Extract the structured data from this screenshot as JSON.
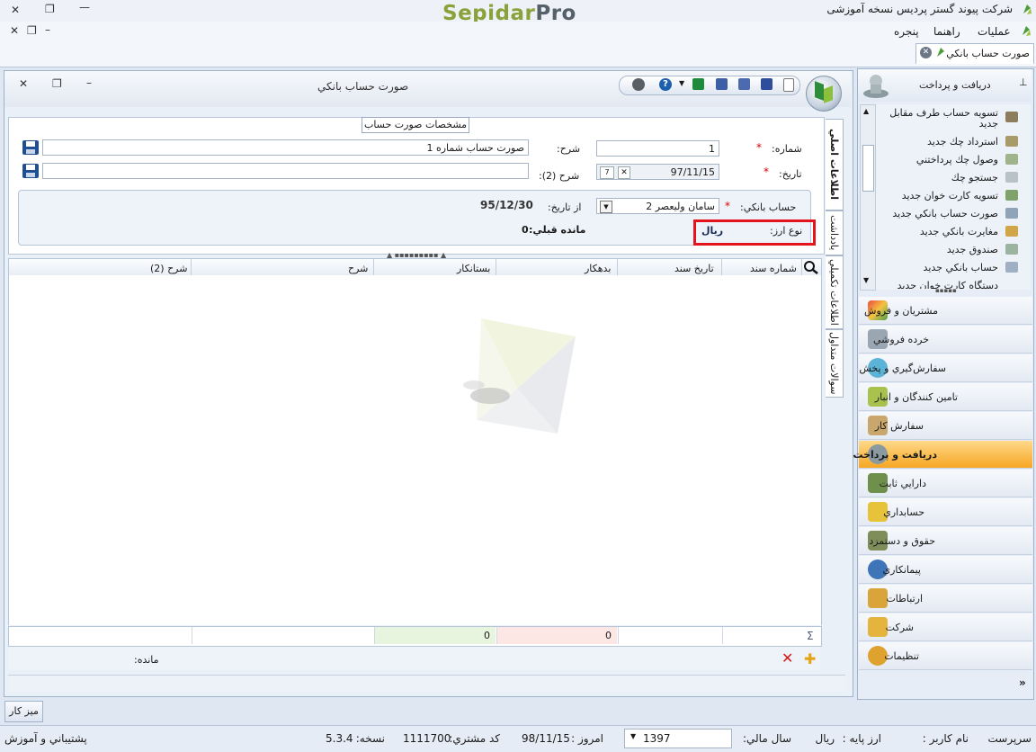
{
  "app": {
    "title": "شرکت پیوند گستر پردیس نسخه آموزشی",
    "logo_part1": "Sepidar",
    "logo_part2": "Pro"
  },
  "menu": {
    "items": [
      "عملیات",
      "راهنما",
      "پنجره"
    ]
  },
  "doc_tab": {
    "label": "صورت حساب بانكي"
  },
  "form_window": {
    "title": "صورت حساب بانكي",
    "section_title": "مشخصات صورت حساب",
    "number_label": "شماره:",
    "number_value": "1",
    "desc_label": "شرح:",
    "desc_value": "صورت حساب شماره 1",
    "date_label": "تاريخ:",
    "date_value": "97/11/15",
    "desc2_label": "شرح (2):",
    "desc2_value": "",
    "bank_label": "حساب بانکي:",
    "bank_value": "سامان وليعصر 2",
    "from_date_label": "از تاريخ:",
    "from_date_value": "95/12/30",
    "prev_balance_label": "مانده قبلي:",
    "prev_balance_value": "0",
    "currency_label": "نوع ارز:",
    "currency_value": "ريال"
  },
  "grid": {
    "columns": [
      "شماره سند",
      "تاريخ سند",
      "بدهكار",
      "بستانكار",
      "شرح",
      "شرح (2)"
    ],
    "sum_debit": "0",
    "sum_credit": "0",
    "balance_label": "مانده:"
  },
  "vertical_tabs": [
    "اطلاعات اصلي",
    "يادداشت",
    "اطلاعات تكميلي",
    "سوالات متداول"
  ],
  "sidebar": {
    "header": "دريافت و پرداخت",
    "sub_items": [
      "تسويه حساب طرف مقابل جديد",
      "استرداد چك جديد",
      "وصول چك پرداختني",
      "جستجو چك",
      "تسويه كارت خوان جديد",
      "صورت حساب بانكي جديد",
      "مغايرت بانكي جديد",
      "صندوق جديد",
      "حساب بانكي جديد",
      "دستگاه كارت خوان جديد"
    ],
    "modules": [
      "مشتريان و فروش",
      "خرده فروشي",
      "سفارش‌گيري و پخش",
      "تامين كنندگان و انبار",
      "سفارش كار",
      "دريافت و پرداخت",
      "دارايي ثابت",
      "حسابداري",
      "حقوق و دستمزد",
      "پيمانكاري",
      "ارتباطات",
      "شركت",
      "تنظيمات"
    ],
    "active_module": "دريافت و پرداخت"
  },
  "taskbar": {
    "desk_label": "ميز كار"
  },
  "status": {
    "username_label": "نام كاربر :",
    "username_value": "سرپرست",
    "base_currency_label": "ارز پايه :",
    "base_currency_value": "ريال",
    "fiscal_year_label": "سال مالي:",
    "fiscal_year_value": "1397",
    "today_label": "امروز :",
    "today_value": "98/11/15",
    "customer_code_label": "كد مشتري:",
    "customer_code_value": "1111700",
    "version_label": "نسخه:",
    "version_value": "5.3.4",
    "support_label": "پشتيباني و آموزش"
  },
  "colors": {
    "accent_active": "#f6a623",
    "highlight_box": "#e3141b",
    "logo_green": "#8ba13a"
  }
}
